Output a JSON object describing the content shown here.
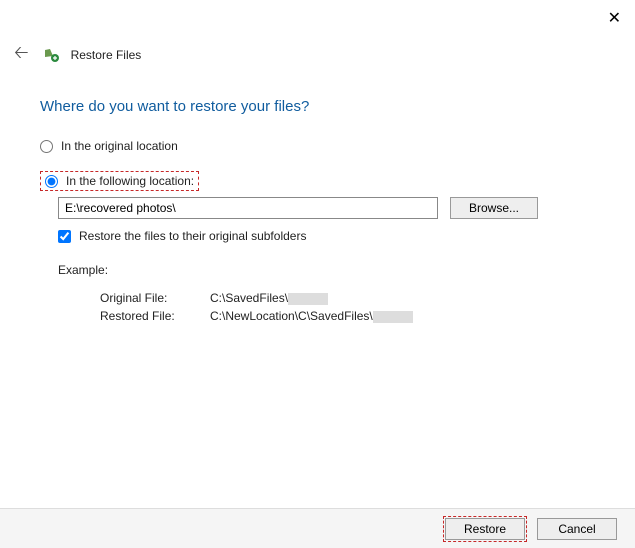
{
  "window": {
    "title": "Restore Files"
  },
  "heading": "Where do you want to restore your files?",
  "options": {
    "original": {
      "label": "In the original location",
      "selected": false
    },
    "following": {
      "label": "In the following location:",
      "selected": true
    }
  },
  "path_input": {
    "value": "E:\\recovered photos\\"
  },
  "buttons": {
    "browse": "Browse...",
    "restore": "Restore",
    "cancel": "Cancel"
  },
  "checkbox": {
    "label": "Restore the files to their original subfolders",
    "checked": true
  },
  "example": {
    "title": "Example:",
    "original_label": "Original File:",
    "original_path": "C:\\SavedFiles\\",
    "restored_label": "Restored File:",
    "restored_path": "C:\\NewLocation\\C\\SavedFiles\\"
  }
}
